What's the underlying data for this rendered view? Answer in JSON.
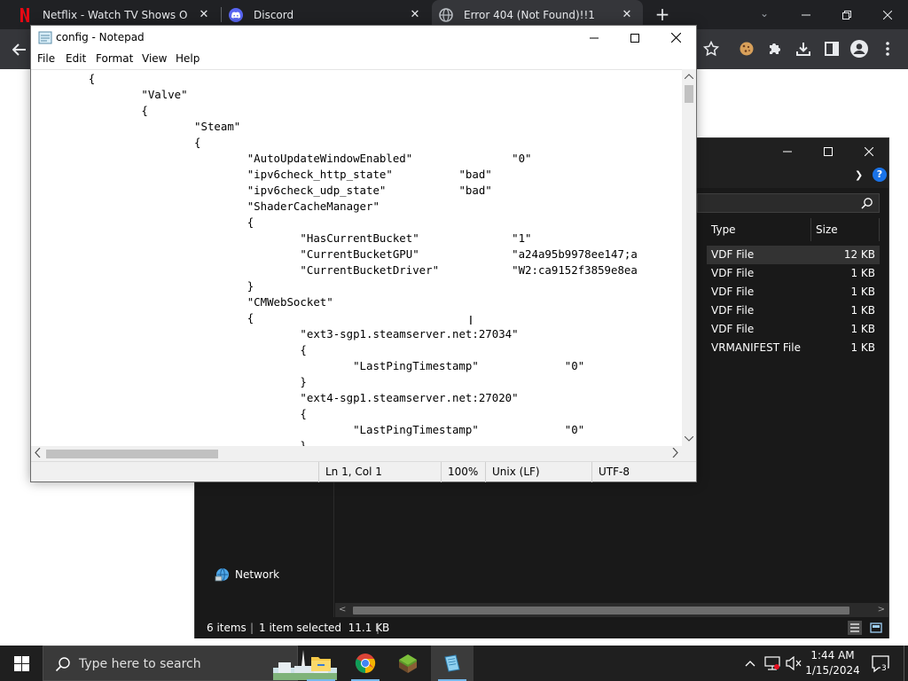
{
  "browser": {
    "tabs": [
      {
        "title": "Netflix - Watch TV Shows Online,",
        "icon": "netflix-icon",
        "color": "#e50914"
      },
      {
        "title": "Discord",
        "icon": "discord-icon",
        "color": "#5865f2"
      },
      {
        "title": "Error 404 (Not Found)!!1",
        "icon": "globe-icon",
        "active": true
      }
    ]
  },
  "explorer": {
    "columns": {
      "type": "Type",
      "size": "Size"
    },
    "rows": [
      {
        "type": "VDF File",
        "size": "12 KB",
        "selected": true
      },
      {
        "type": "VDF File",
        "size": "1 KB"
      },
      {
        "type": "VDF File",
        "size": "1 KB"
      },
      {
        "type": "VDF File",
        "size": "1 KB"
      },
      {
        "type": "VDF File",
        "size": "1 KB"
      },
      {
        "type": "VRMANIFEST File",
        "size": "1 KB"
      }
    ],
    "nav_network": "Network",
    "status": {
      "items": "6 items",
      "selected": "1 item selected  11.1 KB"
    }
  },
  "notepad": {
    "title": "config - Notepad",
    "menu": {
      "file": "File",
      "edit": "Edit",
      "format": "Format",
      "view": "View",
      "help": "Help"
    },
    "content": "\t{\n\t\t\"Valve\"\n\t\t{\n\t\t\t\"Steam\"\n\t\t\t{\n\t\t\t\t\"AutoUpdateWindowEnabled\"\t\t\"0\"\n\t\t\t\t\"ipv6check_http_state\"\t\t\"bad\"\n\t\t\t\t\"ipv6check_udp_state\"\t\t\"bad\"\n\t\t\t\t\"ShaderCacheManager\"\n\t\t\t\t{\n\t\t\t\t\t\"HasCurrentBucket\"\t\t\"1\"\n\t\t\t\t\t\"CurrentBucketGPU\"\t\t\"a24a95b9978ee147;a\n\t\t\t\t\t\"CurrentBucketDriver\"\t\t\"W2:ca9152f3859e8ea\n\t\t\t\t}\n\t\t\t\t\"CMWebSocket\"\n\t\t\t\t{\n\t\t\t\t\t\"ext3-sgp1.steamserver.net:27034\"\n\t\t\t\t\t{\n\t\t\t\t\t\t\"LastPingTimestamp\"\t\t\"0\"\n\t\t\t\t\t}\n\t\t\t\t\t\"ext4-sgp1.steamserver.net:27020\"\n\t\t\t\t\t{\n\t\t\t\t\t\t\"LastPingTimestamp\"\t\t\"0\"\n\t\t\t\t\t}",
    "status": {
      "position": "Ln 1, Col 1",
      "zoom": "100%",
      "eol": "Unix (LF)",
      "encoding": "UTF-8"
    }
  },
  "taskbar": {
    "search_placeholder": "Type here to search",
    "apps": [
      "file-explorer-icon",
      "chrome-icon",
      "minecraft-icon",
      "notepad-icon"
    ],
    "time": "1:44 AM",
    "date": "1/15/2024",
    "notification_count": "3"
  }
}
